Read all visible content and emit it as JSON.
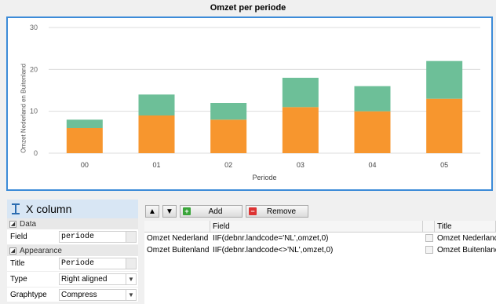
{
  "chart_title": "Omzet per periode",
  "chart_data": {
    "type": "bar",
    "stacked": true,
    "title": "Omzet per periode",
    "xlabel": "Periode",
    "ylabel": "Omzet Nederland en Buitenland",
    "categories": [
      "00",
      "01",
      "02",
      "03",
      "04",
      "05"
    ],
    "ylim": [
      0,
      30
    ],
    "yticks": [
      0,
      10,
      20,
      30
    ],
    "grid": true,
    "series": [
      {
        "name": "Omzet Nederland",
        "color": "#f7962e",
        "values": [
          6,
          9,
          8,
          11,
          10,
          13
        ]
      },
      {
        "name": "Omzet Buitenland",
        "color": "#6dbf98",
        "values": [
          2,
          5,
          4,
          7,
          6,
          9
        ]
      }
    ]
  },
  "panel": {
    "header": "X column",
    "section_data": "Data",
    "section_appearance": "Appearance",
    "props": {
      "field_label": "Field",
      "field_value": "periode",
      "title_label": "Title",
      "title_value": "Periode",
      "type_label": "Type",
      "type_value": "Right aligned",
      "graphtype_label": "Graphtype",
      "graphtype_value": "Compress"
    }
  },
  "toolbar": {
    "up_icon": "arrow-up-icon",
    "down_icon": "arrow-down-icon",
    "add_label": "Add",
    "remove_label": "Remove"
  },
  "grid": {
    "headers": [
      "",
      "Field",
      "",
      "Title"
    ],
    "rows": [
      {
        "name": "Omzet Nederland",
        "field": "IIF(debnr.landcode='NL',omzet,0)",
        "title": "Omzet Nederland"
      },
      {
        "name": "Omzet Buitenland",
        "field": "IIF(debnr.landcode<>'NL',omzet,0)",
        "title": "Omzet Buitenland"
      }
    ]
  }
}
